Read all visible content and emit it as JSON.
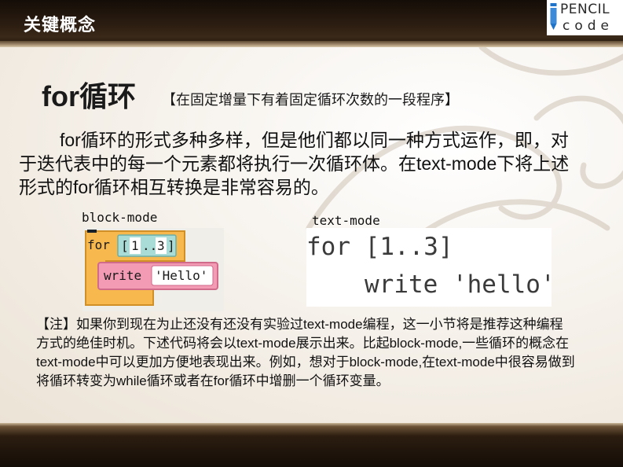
{
  "header": {
    "section_title": "关键概念"
  },
  "logo": {
    "word1": "PENCIL",
    "word2": "code"
  },
  "slide": {
    "heading": "for循环",
    "subtitle": "【在固定增量下有着固定循环次数的一段程序】",
    "intro": "for循环的形式多种多样，但是他们都以同一种方式运作，即，对于迭代表中的每一个元素都将执行一次循环体。在text-mode下将上述形式的for循环相互转换是非常容易的。",
    "block_label": "block-mode",
    "text_label": "text-mode",
    "block": {
      "keyword": "for",
      "range_open": "[",
      "range_a": "1",
      "range_dots": "..",
      "range_b": "3",
      "range_close": "]",
      "cmd": "write",
      "arg": "'Hello'"
    },
    "code": {
      "line1": "for [1..3]",
      "line2": "write 'hello'"
    },
    "note": "【注】如果你到现在为止还没有还没有实验过text-mode编程，这一小节将是推荐这种编程方式的绝佳时机。下述代码将会以text-mode展示出来。比起block-mode,一些循环的概念在text-mode中可以更加方便地表现出来。例如，想对于block-mode,在text-mode中很容易做到将循环转变为while循环或者在for循环中增删一个循环变量。"
  },
  "colors": {
    "block_orange": "#f7b84d",
    "block_teal": "#a9dcd6",
    "block_pink": "#f39ab4",
    "dark_band": "#1e140c"
  }
}
